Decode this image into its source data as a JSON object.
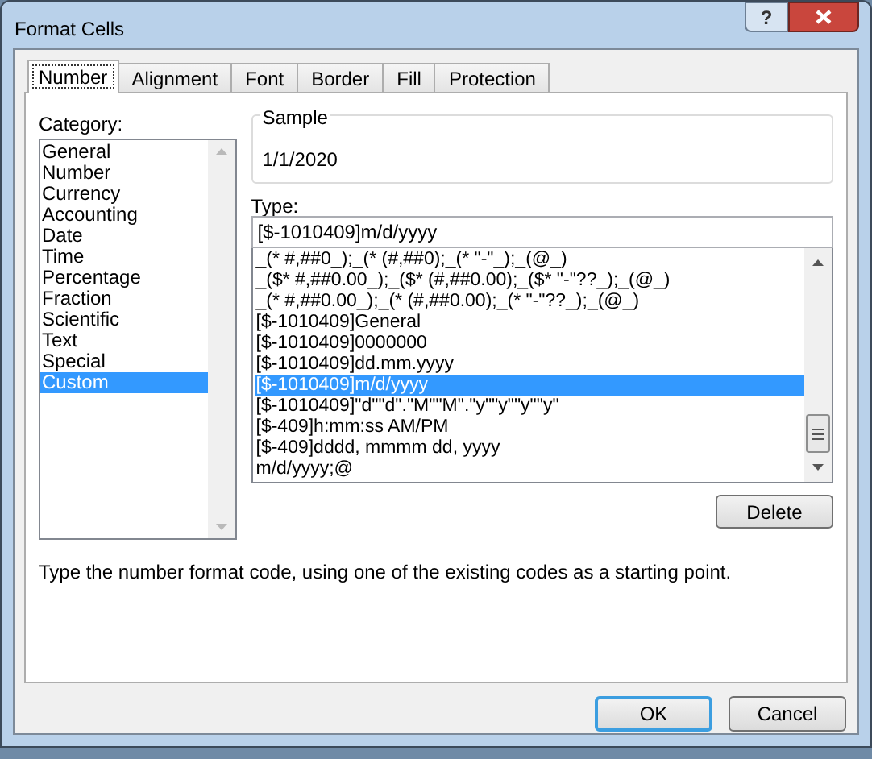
{
  "window": {
    "title": "Format Cells",
    "help_button": "?"
  },
  "tabs": [
    {
      "label": "Number",
      "selected": true
    },
    {
      "label": "Alignment",
      "selected": false
    },
    {
      "label": "Font",
      "selected": false
    },
    {
      "label": "Border",
      "selected": false
    },
    {
      "label": "Fill",
      "selected": false
    },
    {
      "label": "Protection",
      "selected": false
    }
  ],
  "category": {
    "label": "Category:",
    "items": [
      {
        "label": "General",
        "selected": false
      },
      {
        "label": "Number",
        "selected": false
      },
      {
        "label": "Currency",
        "selected": false
      },
      {
        "label": "Accounting",
        "selected": false
      },
      {
        "label": "Date",
        "selected": false
      },
      {
        "label": "Time",
        "selected": false
      },
      {
        "label": "Percentage",
        "selected": false
      },
      {
        "label": "Fraction",
        "selected": false
      },
      {
        "label": "Scientific",
        "selected": false
      },
      {
        "label": "Text",
        "selected": false
      },
      {
        "label": "Special",
        "selected": false
      },
      {
        "label": "Custom",
        "selected": true
      }
    ]
  },
  "sample": {
    "label": "Sample",
    "value": "1/1/2020"
  },
  "type": {
    "label": "Type:",
    "value": "[$-1010409]m/d/yyyy",
    "formats": [
      {
        "label": "_(* #,##0_);_(* (#,##0);_(* \"-\"_);_(@_)",
        "selected": false
      },
      {
        "label": "_($* #,##0.00_);_($* (#,##0.00);_($* \"-\"??_);_(@_)",
        "selected": false
      },
      {
        "label": "_(* #,##0.00_);_(* (#,##0.00);_(* \"-\"??_);_(@_)",
        "selected": false
      },
      {
        "label": "[$-1010409]General",
        "selected": false
      },
      {
        "label": "[$-1010409]0000000",
        "selected": false
      },
      {
        "label": "[$-1010409]dd.mm.yyyy",
        "selected": false
      },
      {
        "label": "[$-1010409]m/d/yyyy",
        "selected": true
      },
      {
        "label": "[$-1010409]\"d\"\"d\".\"M\"\"M\".\"y\"\"y\"\"y\"\"y\"",
        "selected": false
      },
      {
        "label": "[$-409]h:mm:ss AM/PM",
        "selected": false
      },
      {
        "label": "[$-409]dddd, mmmm dd, yyyy",
        "selected": false
      },
      {
        "label": "m/d/yyyy;@",
        "selected": false
      }
    ]
  },
  "delete_button": "Delete",
  "description": "Type the number format code, using one of the existing codes as a starting point.",
  "buttons": [
    {
      "label": "OK",
      "default": true
    },
    {
      "label": "Cancel",
      "default": false
    }
  ]
}
